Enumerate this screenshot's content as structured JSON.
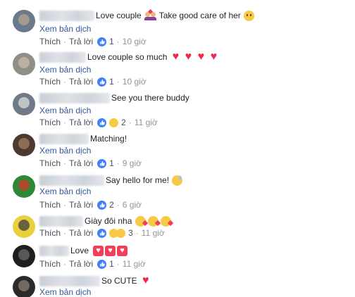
{
  "labels": {
    "translate": "Xem bản dịch",
    "like": "Thích",
    "reply": "Trả lời",
    "separator": "·"
  },
  "comments": [
    {
      "name_blur_width": 78,
      "text": "Love couple",
      "text_after": "Take good care of her",
      "like_count": "1",
      "time": "10 giờ",
      "colors": [
        "#6a7a8c",
        "#b7a58e"
      ]
    },
    {
      "name_blur_width": 66,
      "text": "Love couple so much",
      "like_count": "1",
      "time": "10 giờ",
      "colors": [
        "#8e8f86",
        "#cbbca7"
      ]
    },
    {
      "name_blur_width": 100,
      "text": "See you there buddy",
      "like_count": "2",
      "time": "11 giờ",
      "colors": [
        "#707a86",
        "#dcdcdc"
      ]
    },
    {
      "name_blur_width": 70,
      "text": "Matching!",
      "like_count": "1",
      "time": "9 giờ",
      "colors": [
        "#4c3a30",
        "#a27d5d"
      ]
    },
    {
      "name_blur_width": 92,
      "text": "Say hello for me!",
      "like_count": "2",
      "time": "6 giờ",
      "colors": [
        "#2c8a36",
        "#d23a2a"
      ]
    },
    {
      "name_blur_width": 62,
      "text": "Giày đôi nha",
      "like_count": "3",
      "time": "11 giờ",
      "colors": [
        "#e8d13f",
        "#3d3d3d"
      ]
    },
    {
      "name_blur_width": 42,
      "text": "Love",
      "like_count": "1",
      "time": "11 giờ",
      "colors": [
        "#1f1f1f",
        "#6b6b6b"
      ]
    },
    {
      "name_blur_width": 86,
      "text": "So CUTE",
      "colors": [
        "#2a2a2a",
        "#8e7e72"
      ]
    }
  ]
}
